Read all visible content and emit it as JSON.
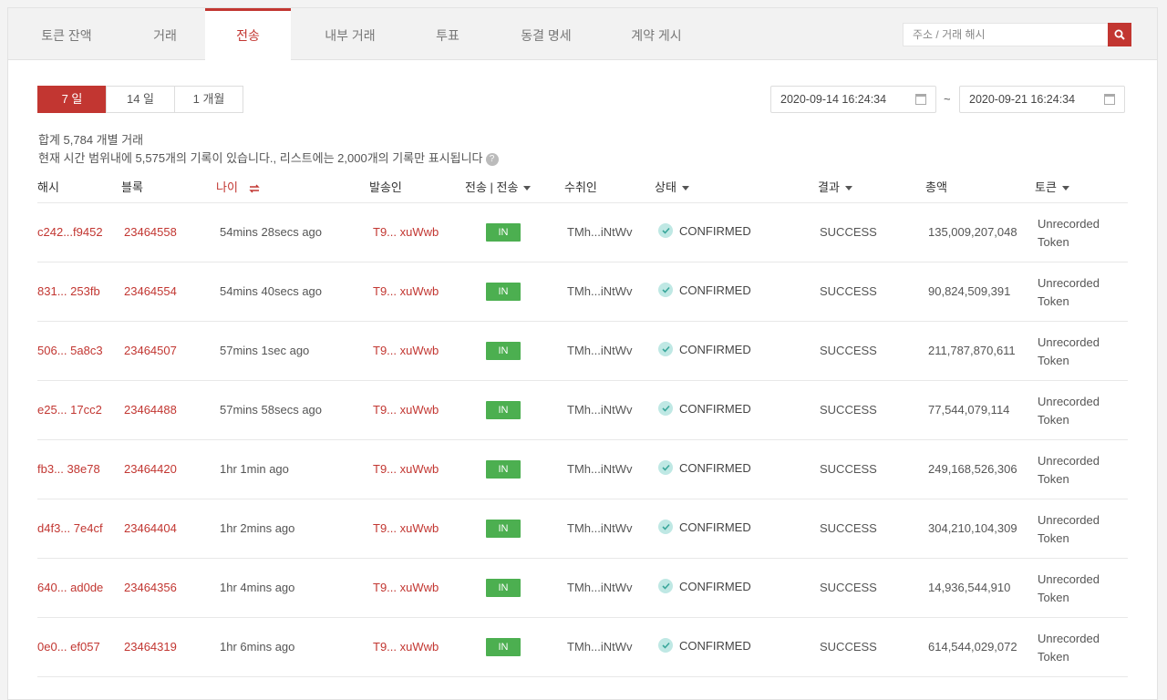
{
  "tabs": [
    {
      "label": "토큰 잔액",
      "active": false
    },
    {
      "label": "거래",
      "active": false
    },
    {
      "label": "전송",
      "active": true
    },
    {
      "label": "내부 거래",
      "active": false
    },
    {
      "label": "투표",
      "active": false
    },
    {
      "label": "동결 명세",
      "active": false
    },
    {
      "label": "계약 게시",
      "active": false
    }
  ],
  "search": {
    "placeholder": "주소 / 거래 해시"
  },
  "periods": [
    {
      "label": "7 일",
      "active": true
    },
    {
      "label": "14 일",
      "active": false
    },
    {
      "label": "1 개월",
      "active": false
    }
  ],
  "dates": {
    "start": "2020-09-14 16:24:34",
    "separator": "~",
    "end": "2020-09-21 16:24:34"
  },
  "summary": {
    "total": "합계 5,784 개별 거래",
    "note": "현재 시간 범위내에 5,575개의 기록이 있습니다., 리스트에는 2,000개의 기록만 표시됩니다",
    "info": "?"
  },
  "columns": {
    "hash": "해시",
    "block": "블록",
    "age": "나이",
    "from": "발송인",
    "type": "전송 | 전송",
    "to": "수취인",
    "status": "상태",
    "result": "결과",
    "amount": "총액",
    "token": "토큰"
  },
  "rows": [
    {
      "hash": "c242...f9452",
      "block": "23464558",
      "age": "54mins 28secs ago",
      "from": "T9... xuWwb",
      "type": "IN",
      "to": "TMh...iNtWv",
      "status": "CONFIRMED",
      "result": "SUCCESS",
      "amount": "135,009,207,048",
      "token": "Unrecorded Token"
    },
    {
      "hash": "831... 253fb",
      "block": "23464554",
      "age": "54mins 40secs ago",
      "from": "T9... xuWwb",
      "type": "IN",
      "to": "TMh...iNtWv",
      "status": "CONFIRMED",
      "result": "SUCCESS",
      "amount": "90,824,509,391",
      "token": "Unrecorded Token"
    },
    {
      "hash": "506... 5a8c3",
      "block": "23464507",
      "age": "57mins 1sec ago",
      "from": "T9... xuWwb",
      "type": "IN",
      "to": "TMh...iNtWv",
      "status": "CONFIRMED",
      "result": "SUCCESS",
      "amount": "211,787,870,611",
      "token": "Unrecorded Token"
    },
    {
      "hash": "e25... 17cc2",
      "block": "23464488",
      "age": "57mins 58secs ago",
      "from": "T9... xuWwb",
      "type": "IN",
      "to": "TMh...iNtWv",
      "status": "CONFIRMED",
      "result": "SUCCESS",
      "amount": "77,544,079,114",
      "token": "Unrecorded Token"
    },
    {
      "hash": "fb3... 38e78",
      "block": "23464420",
      "age": "1hr 1min ago",
      "from": "T9... xuWwb",
      "type": "IN",
      "to": "TMh...iNtWv",
      "status": "CONFIRMED",
      "result": "SUCCESS",
      "amount": "249,168,526,306",
      "token": "Unrecorded Token"
    },
    {
      "hash": "d4f3... 7e4cf",
      "block": "23464404",
      "age": "1hr 2mins ago",
      "from": "T9... xuWwb",
      "type": "IN",
      "to": "TMh...iNtWv",
      "status": "CONFIRMED",
      "result": "SUCCESS",
      "amount": "304,210,104,309",
      "token": "Unrecorded Token"
    },
    {
      "hash": "640... ad0de",
      "block": "23464356",
      "age": "1hr 4mins ago",
      "from": "T9... xuWwb",
      "type": "IN",
      "to": "TMh...iNtWv",
      "status": "CONFIRMED",
      "result": "SUCCESS",
      "amount": "14,936,544,910",
      "token": "Unrecorded Token"
    },
    {
      "hash": "0e0... ef057",
      "block": "23464319",
      "age": "1hr 6mins ago",
      "from": "T9... xuWwb",
      "type": "IN",
      "to": "TMh...iNtWv",
      "status": "CONFIRMED",
      "result": "SUCCESS",
      "amount": "614,544,029,072",
      "token": "Unrecorded Token"
    }
  ],
  "colors": {
    "accent": "#c23631",
    "in_badge": "#4caf50",
    "confirmed_icon_bg": "#bfe8e4",
    "confirmed_icon": "#3aa79b"
  }
}
